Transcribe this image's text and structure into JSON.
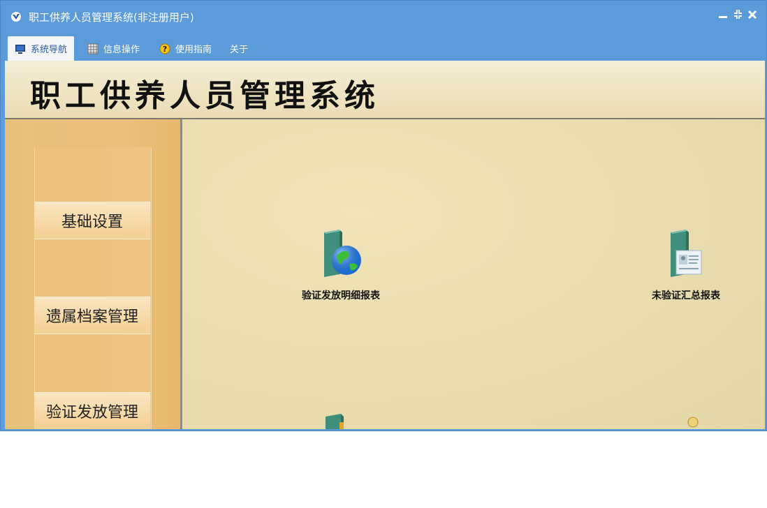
{
  "window": {
    "title": "职工供养人员管理系统(非注册用户)",
    "controls": {
      "minimize_icon": "minimize-icon",
      "restore_icon": "restore-icon",
      "close_icon": "close-icon"
    }
  },
  "ribbon": {
    "tabs": [
      {
        "label": "系统导航",
        "icon": "monitor-icon",
        "active": true
      },
      {
        "label": "信息操作",
        "icon": "grid-icon",
        "active": false
      },
      {
        "label": "使用指南",
        "icon": "help-icon",
        "active": false
      },
      {
        "label": "关于",
        "icon": "",
        "active": false
      }
    ]
  },
  "header": {
    "title": "职工供养人员管理系统"
  },
  "sidebar": {
    "items": [
      {
        "label": "基础设置"
      },
      {
        "label": "遗属档案管理"
      },
      {
        "label": "验证发放管理"
      }
    ]
  },
  "main": {
    "tiles": [
      {
        "label": "验证发放明细报表",
        "icon": "globe-folder-icon"
      },
      {
        "label": "未验证汇总报表",
        "icon": "contact-card-folder-icon"
      },
      {
        "label": "",
        "icon": "folder-icon"
      },
      {
        "label": "",
        "icon": "user-icon"
      }
    ]
  },
  "colors": {
    "titlebar": "#5c9bd9",
    "content_bg": "#efe6c2",
    "sidebar_bg": "#ecc07b",
    "active_tab_text": "#2b5aa5"
  }
}
